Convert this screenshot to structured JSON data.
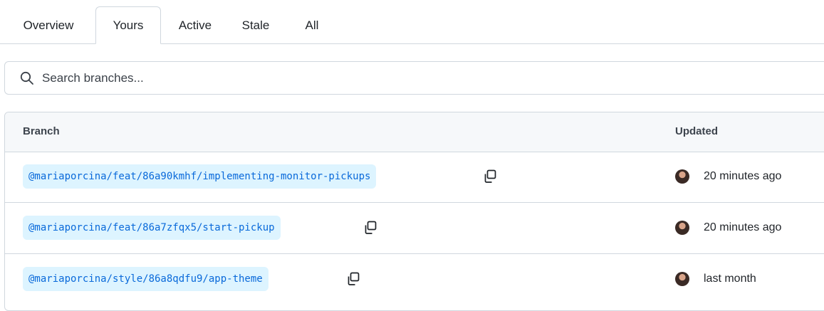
{
  "tabs": [
    {
      "label": "Overview"
    },
    {
      "label": "Yours",
      "active": true
    },
    {
      "label": "Active"
    },
    {
      "label": "Stale"
    },
    {
      "label": "All"
    }
  ],
  "search": {
    "placeholder": "Search branches..."
  },
  "table": {
    "headers": {
      "branch": "Branch",
      "updated": "Updated"
    },
    "rows": [
      {
        "branch": "@mariaporcina/feat/86a90kmhf/implementing-monitor-pickups",
        "updated": "20 minutes ago"
      },
      {
        "branch": "@mariaporcina/feat/86a7zfqx5/start-pickup",
        "updated": "20 minutes ago"
      },
      {
        "branch": "@mariaporcina/style/86a8qdfu9/app-theme",
        "updated": "last month"
      }
    ]
  },
  "colors": {
    "branch_bg": "#ddf4ff",
    "branch_text": "#0969da",
    "border": "#d0d7de",
    "header_bg": "#f6f8fa"
  },
  "icons": {
    "search": "search-icon",
    "copy": "copy-icon",
    "avatar": "avatar"
  }
}
